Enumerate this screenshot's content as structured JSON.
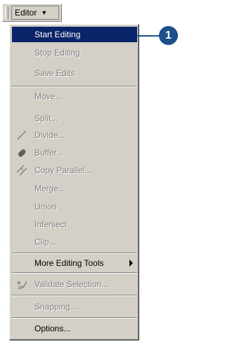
{
  "toolbar": {
    "menu_label": "Editor"
  },
  "menu": {
    "start_editing": "Start Editing",
    "stop_editing": "Stop Editing",
    "save_edits": "Save Edits",
    "move": "Move...",
    "split": "Split...",
    "divide": "Divide...",
    "buffer": "Buffer...",
    "copy_parallel": "Copy Parallel...",
    "merge": "Merge...",
    "union": "Union",
    "intersect": "Intersect",
    "clip": "Clip...",
    "more_editing_tools": "More Editing Tools",
    "validate_selection": "Validate Selection...",
    "snapping": "Snapping...",
    "options": "Options..."
  },
  "callout": {
    "number": "1"
  },
  "icons": {
    "divide": "divide-line-icon",
    "buffer": "buffer-icon",
    "copy_parallel": "copy-parallel-icon",
    "validate": "validate-selection-icon",
    "submenu": "submenu-arrow-icon",
    "dropdown": "dropdown-arrow-icon"
  },
  "colors": {
    "highlight": "#0a246a",
    "callout": "#1d4f88",
    "menu_bg": "#d4d0c8"
  }
}
